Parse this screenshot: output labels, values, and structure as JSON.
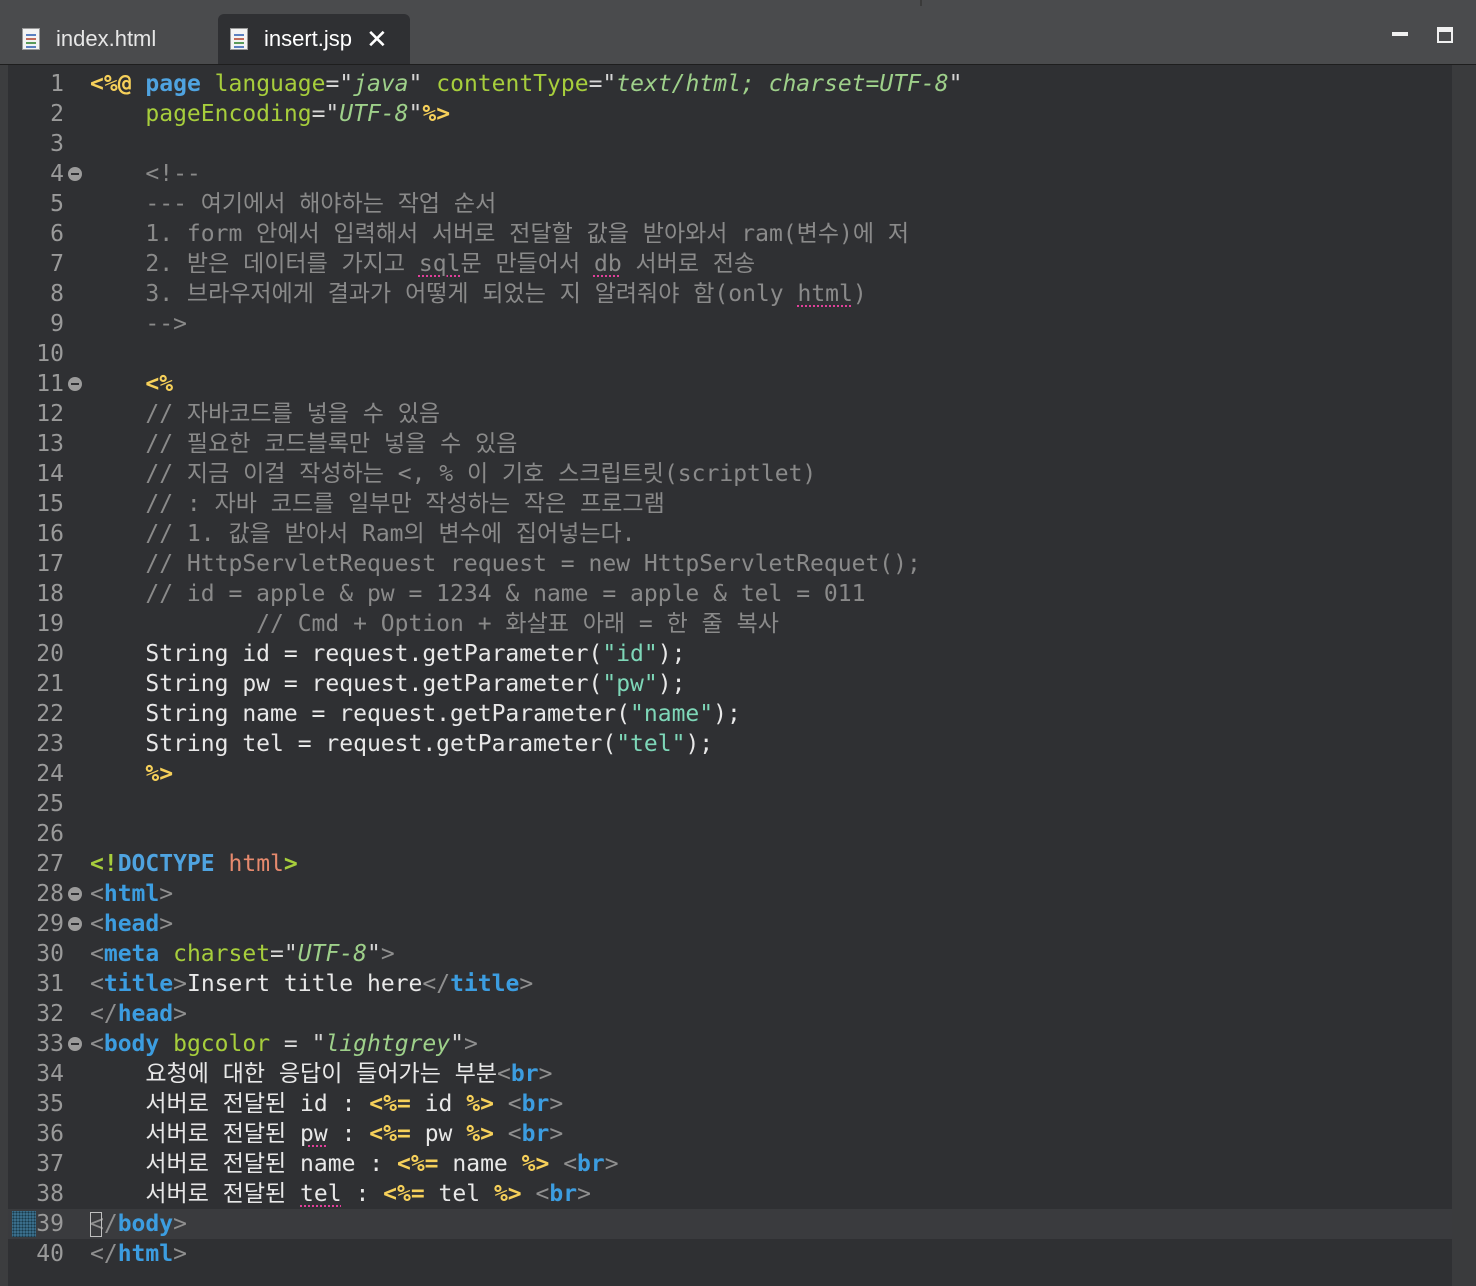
{
  "tabs": [
    {
      "label": "index.html",
      "active": false,
      "icon": "file-icon"
    },
    {
      "label": "insert.jsp",
      "active": true,
      "icon": "file-icon",
      "close_icon": "close-icon"
    }
  ],
  "window_controls": [
    "minimize-icon",
    "maximize-icon"
  ],
  "colors": {
    "jsp_delimiter": "#f6d05a",
    "directive": "#4fa3e0",
    "attribute": "#a7ce3c",
    "attribute_value": "#9ed08a",
    "comment": "#8a8a8a",
    "tag": "#3c9de0",
    "string": "#7ed7b8",
    "doctype_html": "#e78a6e",
    "editor_bg": "#2f3033"
  },
  "editor": {
    "current_line": 39,
    "folded_lines": [
      4,
      11,
      28,
      29,
      33
    ],
    "lines": [
      {
        "n": "1",
        "tokens": [
          [
            "jsp",
            "<%@"
          ],
          [
            "t",
            " "
          ],
          [
            "dir",
            "page"
          ],
          [
            "t",
            " "
          ],
          [
            "attr",
            "language"
          ],
          [
            "q",
            "=\""
          ],
          [
            "val",
            "java"
          ],
          [
            "q",
            "\""
          ],
          [
            "t",
            " "
          ],
          [
            "attr",
            "contentType"
          ],
          [
            "q",
            "=\""
          ],
          [
            "val",
            "text/html; charset=UTF-8"
          ],
          [
            "q",
            "\""
          ]
        ]
      },
      {
        "n": "2",
        "tokens": [
          [
            "t",
            "    "
          ],
          [
            "attr",
            "pageEncoding"
          ],
          [
            "q",
            "=\""
          ],
          [
            "val",
            "UTF-8"
          ],
          [
            "q",
            "\""
          ],
          [
            "jsp",
            "%>"
          ]
        ]
      },
      {
        "n": "3",
        "tokens": []
      },
      {
        "n": "4",
        "tokens": [
          [
            "com",
            "    <!--"
          ]
        ]
      },
      {
        "n": "5",
        "tokens": [
          [
            "com",
            "    --- 여기에서 해야하는 작업 순서"
          ]
        ]
      },
      {
        "n": "6",
        "tokens": [
          [
            "com",
            "    1. form 안에서 입력해서 서버로 전달할 값을 받아와서 ram(변수)에 저"
          ]
        ]
      },
      {
        "n": "7",
        "tokens": [
          [
            "com",
            "    2. 받은 데이터를 가지고 "
          ],
          [
            "comspell",
            "sql"
          ],
          [
            "com",
            "문 만들어서 "
          ],
          [
            "comspell",
            "db"
          ],
          [
            "com",
            " 서버로 전송"
          ]
        ]
      },
      {
        "n": "8",
        "tokens": [
          [
            "com",
            "    3. 브라우저에게 결과가 어떻게 되었는 지 알려줘야 함(only "
          ],
          [
            "comspell",
            "html"
          ],
          [
            "com",
            ")"
          ]
        ]
      },
      {
        "n": "9",
        "tokens": [
          [
            "com",
            "    -->"
          ]
        ]
      },
      {
        "n": "10",
        "tokens": []
      },
      {
        "n": "11",
        "tokens": [
          [
            "t",
            "    "
          ],
          [
            "jsp",
            "<%"
          ]
        ]
      },
      {
        "n": "12",
        "tokens": [
          [
            "com",
            "    // 자바코드를 넣을 수 있음"
          ]
        ]
      },
      {
        "n": "13",
        "tokens": [
          [
            "com",
            "    // 필요한 코드블록만 넣을 수 있음"
          ]
        ]
      },
      {
        "n": "14",
        "tokens": [
          [
            "com",
            "    // 지금 이걸 작성하는 <, % 이 기호 스크립트릿(scriptlet)"
          ]
        ]
      },
      {
        "n": "15",
        "tokens": [
          [
            "com",
            "    // : 자바 코드를 일부만 작성하는 작은 프로그램"
          ]
        ]
      },
      {
        "n": "16",
        "tokens": [
          [
            "com",
            "    // 1. 값을 받아서 Ram의 변수에 집어넣는다."
          ]
        ]
      },
      {
        "n": "17",
        "tokens": [
          [
            "com",
            "    // HttpServletRequest request = new HttpServletRequet();"
          ]
        ]
      },
      {
        "n": "18",
        "tokens": [
          [
            "com",
            "    // id = apple & pw = 1234 & name = apple & tel = 011"
          ]
        ]
      },
      {
        "n": "19",
        "tokens": [
          [
            "com",
            "            // Cmd + Option + 화살표 아래 = 한 줄 복사"
          ]
        ]
      },
      {
        "n": "20",
        "tokens": [
          [
            "t",
            "    String id = request.getParameter("
          ],
          [
            "str",
            "\"id\""
          ],
          [
            "t",
            ");"
          ]
        ]
      },
      {
        "n": "21",
        "tokens": [
          [
            "t",
            "    String pw = request.getParameter("
          ],
          [
            "str",
            "\"pw\""
          ],
          [
            "t",
            ");"
          ]
        ]
      },
      {
        "n": "22",
        "tokens": [
          [
            "t",
            "    String name = request.getParameter("
          ],
          [
            "str",
            "\"name\""
          ],
          [
            "t",
            ");"
          ]
        ]
      },
      {
        "n": "23",
        "tokens": [
          [
            "t",
            "    String tel = request.getParameter("
          ],
          [
            "str",
            "\"tel\""
          ],
          [
            "t",
            ");"
          ]
        ]
      },
      {
        "n": "24",
        "tokens": [
          [
            "t",
            "    "
          ],
          [
            "jsp",
            "%>"
          ]
        ]
      },
      {
        "n": "25",
        "tokens": []
      },
      {
        "n": "26",
        "tokens": []
      },
      {
        "n": "27",
        "tokens": [
          [
            "doct",
            "<!"
          ],
          [
            "doctk",
            "DOCTYPE"
          ],
          [
            "t",
            " "
          ],
          [
            "html",
            "html"
          ],
          [
            "doct",
            ">"
          ]
        ]
      },
      {
        "n": "28",
        "tokens": [
          [
            "angle",
            "<"
          ],
          [
            "tag",
            "html"
          ],
          [
            "angle",
            ">"
          ]
        ]
      },
      {
        "n": "29",
        "tokens": [
          [
            "angle",
            "<"
          ],
          [
            "tag",
            "head"
          ],
          [
            "angle",
            ">"
          ]
        ]
      },
      {
        "n": "30",
        "tokens": [
          [
            "angle",
            "<"
          ],
          [
            "tag",
            "meta"
          ],
          [
            "t",
            " "
          ],
          [
            "attr",
            "charset"
          ],
          [
            "q",
            "=\""
          ],
          [
            "val",
            "UTF-8"
          ],
          [
            "q",
            "\""
          ],
          [
            "angle",
            ">"
          ]
        ]
      },
      {
        "n": "31",
        "tokens": [
          [
            "angle",
            "<"
          ],
          [
            "tag",
            "title"
          ],
          [
            "angle",
            ">"
          ],
          [
            "t",
            "Insert title here"
          ],
          [
            "angle",
            "</"
          ],
          [
            "tag",
            "title"
          ],
          [
            "angle",
            ">"
          ]
        ]
      },
      {
        "n": "32",
        "tokens": [
          [
            "angle",
            "</"
          ],
          [
            "tag",
            "head"
          ],
          [
            "angle",
            ">"
          ]
        ]
      },
      {
        "n": "33",
        "tokens": [
          [
            "angle",
            "<"
          ],
          [
            "tag",
            "body"
          ],
          [
            "t",
            " "
          ],
          [
            "attr",
            "bgcolor"
          ],
          [
            "t",
            " "
          ],
          [
            "q",
            "="
          ],
          [
            "t",
            " "
          ],
          [
            "q",
            "\""
          ],
          [
            "val",
            "lightgrey"
          ],
          [
            "q",
            "\""
          ],
          [
            "angle",
            ">"
          ]
        ]
      },
      {
        "n": "34",
        "tokens": [
          [
            "t",
            "    요청에 대한 응답이 들어가는 부분"
          ],
          [
            "angle",
            "<"
          ],
          [
            "tag",
            "br"
          ],
          [
            "angle",
            ">"
          ]
        ]
      },
      {
        "n": "35",
        "tokens": [
          [
            "t",
            "    서버로 전달된 id : "
          ],
          [
            "jsp",
            "<%="
          ],
          [
            "t",
            " id "
          ],
          [
            "jsp",
            "%>"
          ],
          [
            "t",
            " "
          ],
          [
            "angle",
            "<"
          ],
          [
            "tag",
            "br"
          ],
          [
            "angle",
            ">"
          ]
        ]
      },
      {
        "n": "36",
        "tokens": [
          [
            "t",
            "    서버로 전달된 "
          ],
          [
            "spell",
            "pw"
          ],
          [
            "t",
            " : "
          ],
          [
            "jsp",
            "<%="
          ],
          [
            "t",
            " pw "
          ],
          [
            "jsp",
            "%>"
          ],
          [
            "t",
            " "
          ],
          [
            "angle",
            "<"
          ],
          [
            "tag",
            "br"
          ],
          [
            "angle",
            ">"
          ]
        ]
      },
      {
        "n": "37",
        "tokens": [
          [
            "t",
            "    서버로 전달된 name : "
          ],
          [
            "jsp",
            "<%="
          ],
          [
            "t",
            " name "
          ],
          [
            "jsp",
            "%>"
          ],
          [
            "t",
            " "
          ],
          [
            "angle",
            "<"
          ],
          [
            "tag",
            "br"
          ],
          [
            "angle",
            ">"
          ]
        ]
      },
      {
        "n": "38",
        "tokens": [
          [
            "t",
            "    서버로 전달된 "
          ],
          [
            "spell",
            "tel"
          ],
          [
            "t",
            " : "
          ],
          [
            "jsp",
            "<%="
          ],
          [
            "t",
            " tel "
          ],
          [
            "jsp",
            "%>"
          ],
          [
            "t",
            " "
          ],
          [
            "angle",
            "<"
          ],
          [
            "tag",
            "br"
          ],
          [
            "angle",
            ">"
          ]
        ]
      },
      {
        "n": "39",
        "tokens": [
          [
            "angle",
            "</"
          ],
          [
            "tag",
            "body"
          ],
          [
            "angle",
            ">"
          ]
        ]
      },
      {
        "n": "40",
        "tokens": [
          [
            "angle",
            "</"
          ],
          [
            "tag",
            "html"
          ],
          [
            "angle",
            ">"
          ]
        ]
      }
    ]
  }
}
